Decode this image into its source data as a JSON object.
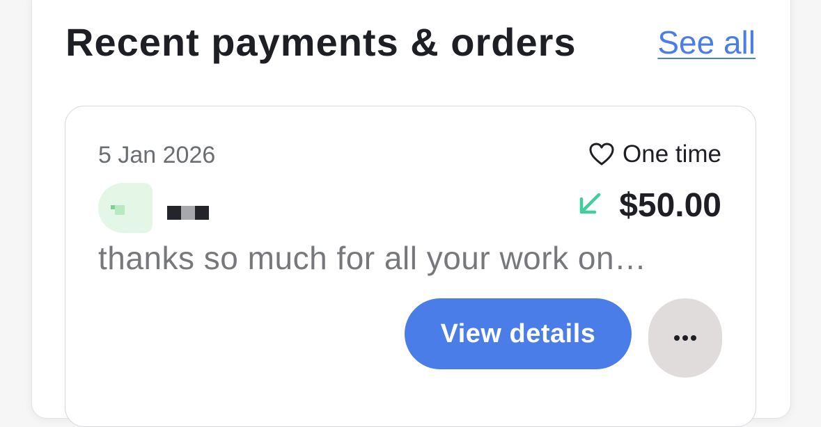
{
  "section": {
    "title": "Recent payments & orders",
    "see_all_label": "See all"
  },
  "payment": {
    "date": "5 Jan 2026",
    "frequency_icon": "heart-outline-icon",
    "frequency": "One time",
    "direction_icon": "arrow-down-left-icon",
    "amount": "$50.00",
    "message": "thanks so much for all your work on…",
    "view_details_label": "View details",
    "more_icon": "ellipsis-icon"
  },
  "colors": {
    "accent": "#4a7de8",
    "incoming_arrow": "#3fcf9c",
    "avatar_bg": "#e4f7e7",
    "more_button_bg": "#e1dcdc"
  }
}
